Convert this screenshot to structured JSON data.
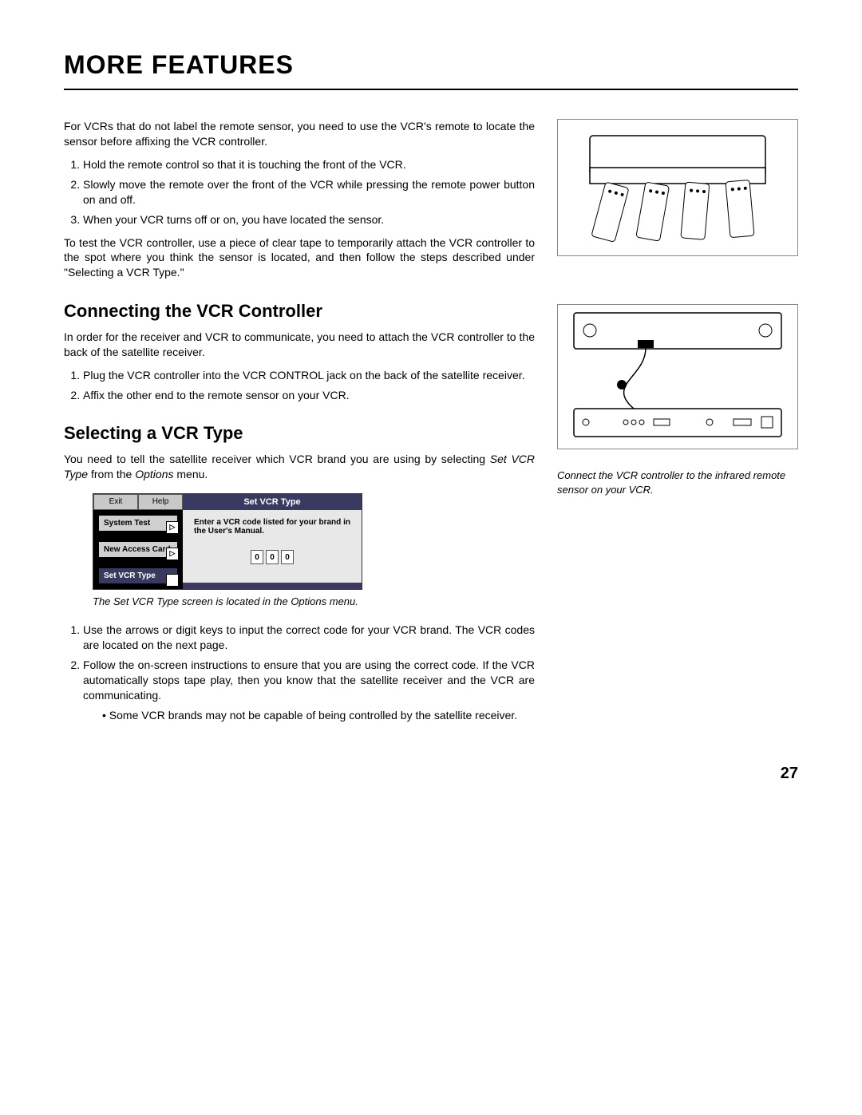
{
  "title": "MORE FEATURES",
  "intro": "For VCRs that do not label the remote sensor, you need to use the VCR's remote to locate the sensor before affixing the VCR controller.",
  "ol1": {
    "i1": "Hold the remote control so that it is touching the front of the VCR.",
    "i2": "Slowly move the remote over the front of the VCR while pressing the remote power button on and off.",
    "i3": "When your VCR turns off or on, you have located the sensor."
  },
  "aftertest": "To test the VCR controller, use a piece of clear tape to temporarily attach the VCR controller to the spot where you think the sensor is located, and then follow the steps described under \"Selecting a VCR Type.\"",
  "h2_connect": "Connecting the VCR Controller",
  "connect_p": "In order for the receiver and VCR to communicate, you need to attach the VCR controller to the back of the satellite receiver.",
  "ol2": {
    "i1": "Plug the VCR controller into the VCR CONTROL jack on the back of the satellite receiver.",
    "i2": "Affix the other end to the remote sensor on your VCR."
  },
  "h2_select": "Selecting a VCR Type",
  "select_p_a": "You need to tell the satellite receiver which VCR brand you are using by selecting ",
  "select_p_b": "Set VCR Type",
  "select_p_c": " from the ",
  "select_p_d": "Options",
  "select_p_e": " menu.",
  "menu": {
    "exit": "Exit",
    "help": "Help",
    "system_test": "System Test",
    "new_access": "New Access Card",
    "set_vcr": "Set VCR Type",
    "panel_title": "Set VCR Type",
    "panel_text": "Enter a VCR code listed for your brand in the User's Manual.",
    "d1": "0",
    "d2": "0",
    "d3": "0"
  },
  "menu_caption": "The Set VCR Type screen is located in the Options menu.",
  "ol3": {
    "i1": "Use the arrows or digit keys to input the correct code for your VCR brand. The VCR codes are located on the next page.",
    "i2": "Follow the on-screen instructions to ensure that you are using the correct code. If the VCR automatically stops tape play, then you know that the satellite receiver and the VCR are communicating.",
    "b1": "Some VCR brands may not be capable of being controlled by the satellite receiver."
  },
  "fig_caption": "Connect the VCR controller to the infrared remote sensor on your VCR.",
  "page_number": "27"
}
